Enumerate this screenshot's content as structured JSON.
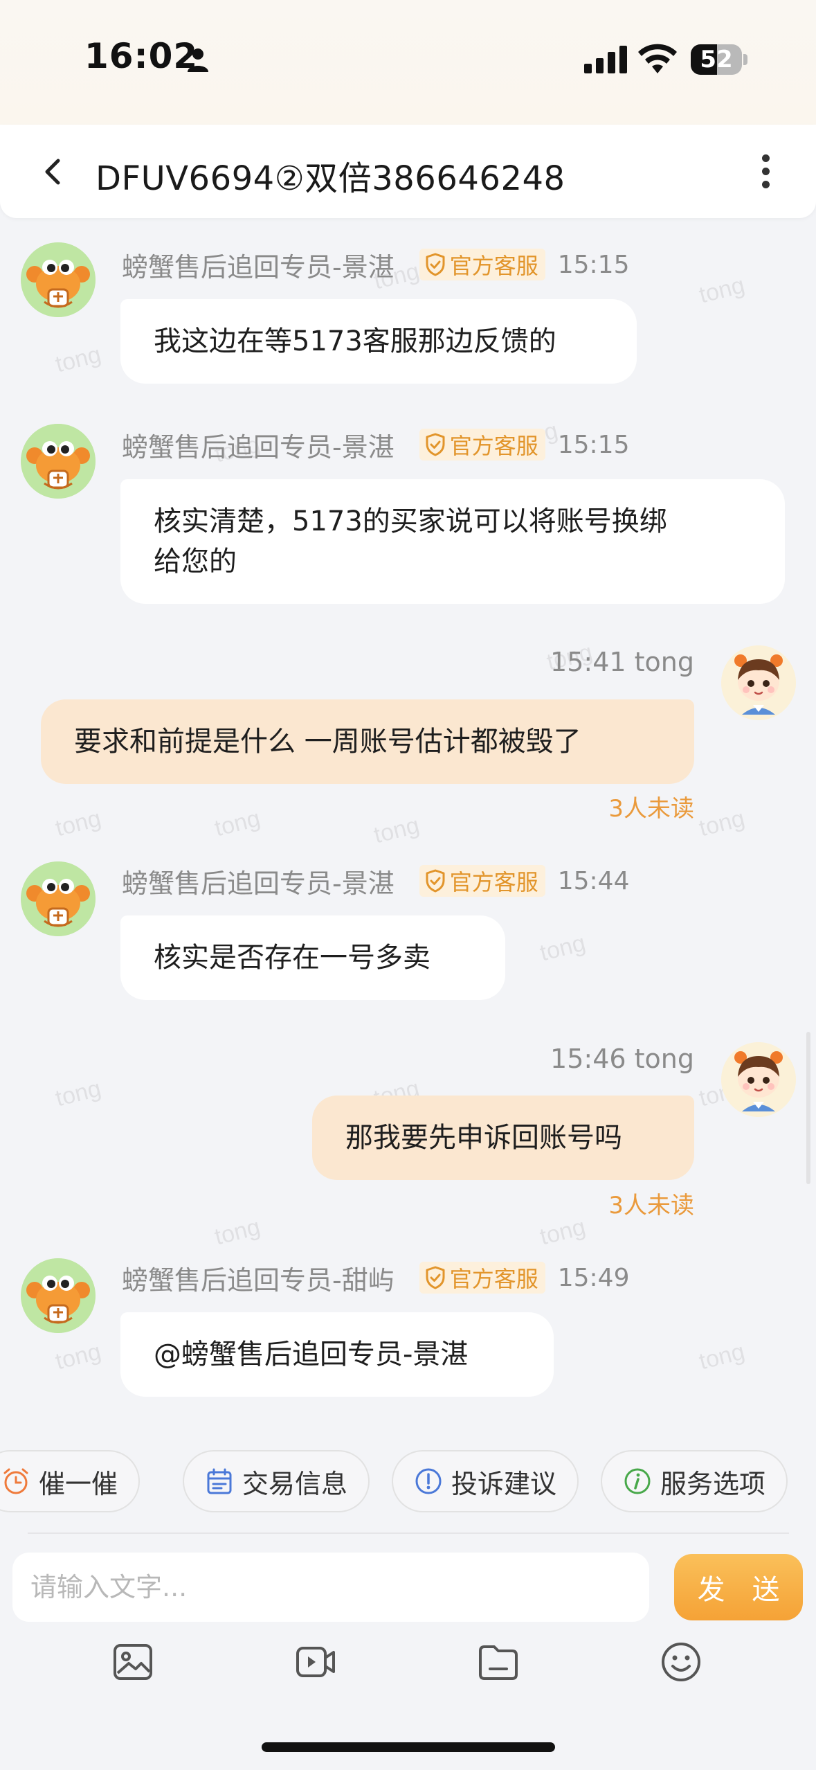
{
  "status_bar": {
    "time": "16:02",
    "battery": "52",
    "battery_level": 0.52
  },
  "header": {
    "title": "DFUV6694②双倍386646248",
    "back_icon": "chevron-left-icon",
    "more_icon": "vertical-dots-icon"
  },
  "watermark": "tong",
  "messages": [
    {
      "direction": "in",
      "sender": "螃蟹售后追回专员-景湛",
      "badge": "官方客服",
      "time": "15:15",
      "text": "我这边在等5173客服那边反馈的"
    },
    {
      "direction": "in",
      "sender": "螃蟹售后追回专员-景湛",
      "badge": "官方客服",
      "time": "15:15",
      "text_lines": [
        "核实清楚，5173的买家说可以将账号换绑",
        "给您的"
      ]
    },
    {
      "direction": "out",
      "meta": "15:41 tong",
      "text": "要求和前提是什么  一周账号估计都被毁了",
      "read_status": "3人未读"
    },
    {
      "direction": "in",
      "sender": "螃蟹售后追回专员-景湛",
      "badge": "官方客服",
      "time": "15:44",
      "text": "核实是否存在一号多卖"
    },
    {
      "direction": "out",
      "meta": "15:46 tong",
      "text": "那我要先申诉回账号吗",
      "read_status": "3人未读"
    },
    {
      "direction": "in",
      "sender": "螃蟹售后追回专员-甜屿",
      "badge": "官方客服",
      "time": "15:49",
      "text": "@螃蟹售后追回专员-景湛"
    }
  ],
  "quick_actions": [
    {
      "label": "催一催",
      "icon": "alarm-clock-icon"
    },
    {
      "label": "交易信息",
      "icon": "calendar-icon"
    },
    {
      "label": "投诉建议",
      "icon": "exclamation-circle-icon"
    },
    {
      "label": "服务选项",
      "icon": "info-circle-icon"
    }
  ],
  "composer": {
    "placeholder": "请输入文字...",
    "send_label": "发 送"
  },
  "toolbar": {
    "icons": [
      "image-icon",
      "video-icon",
      "folder-icon",
      "emoji-icon"
    ]
  },
  "colors": {
    "accent": "#f5a236",
    "badge_text": "#e2952b",
    "outgoing_bubble": "#fbe7d0",
    "read_status": "#ea9a3c"
  }
}
